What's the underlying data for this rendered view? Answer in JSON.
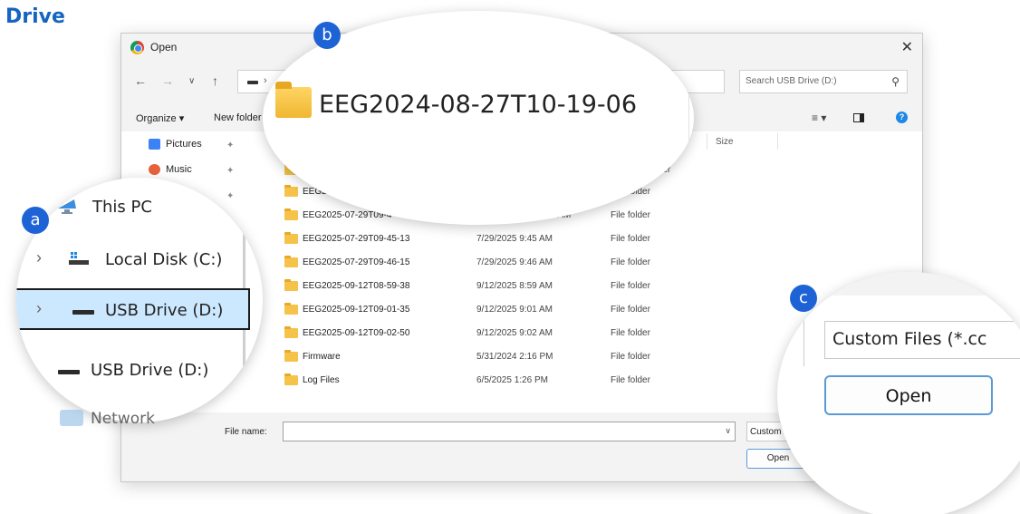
{
  "page": {
    "title": "Drive"
  },
  "dialog": {
    "title": "Open",
    "search_placeholder": "Search USB Drive (D:)",
    "toolbar": {
      "organize": "Organize ▾",
      "new_folder": "New folder"
    },
    "columns": {
      "size": "Size"
    },
    "nav_items": [
      {
        "label": "Pictures",
        "color": "#3b82f6"
      },
      {
        "label": "Music",
        "color": "#e8613c"
      },
      {
        "label": "s",
        "color": "#9ca3af"
      }
    ],
    "partial_text": {
      "nav_fragment": ":)",
      "row0_type": "older",
      "row1_name": "EEG20",
      "row2_name": "EEG2025-07-29T09-4",
      "row2_date": "44 AM"
    },
    "files": [
      {
        "name": "EEG2025-07-29T09-45-13",
        "date": "7/29/2025 9:45 AM",
        "type": "File folder"
      },
      {
        "name": "EEG2025-07-29T09-46-15",
        "date": "7/29/2025 9:46 AM",
        "type": "File folder"
      },
      {
        "name": "EEG2025-09-12T08-59-38",
        "date": "9/12/2025 8:59 AM",
        "type": "File folder"
      },
      {
        "name": "EEG2025-09-12T09-01-35",
        "date": "9/12/2025 9:01 AM",
        "type": "File folder"
      },
      {
        "name": "EEG2025-09-12T09-02-50",
        "date": "9/12/2025 9:02 AM",
        "type": "File folder"
      },
      {
        "name": "Firmware",
        "date": "5/31/2024 2:16 PM",
        "type": "File folder"
      },
      {
        "name": "Log Files",
        "date": "6/5/2025 1:26 PM",
        "type": "File folder"
      }
    ],
    "partial_rows_type": [
      "File folder",
      "File folder"
    ],
    "file_name_label": "File name:",
    "file_name_value": "",
    "filter_label": "Custom",
    "open_label": "Open"
  },
  "magnifier_b": {
    "folder_name": "EEG2024-08-27T10-19-06"
  },
  "magnifier_a": {
    "items": [
      {
        "label": "This PC"
      },
      {
        "label": "Local Disk (C:)"
      },
      {
        "label": "USB Drive (D:)",
        "selected": true
      },
      {
        "label": "USB Drive (D:)"
      }
    ],
    "network": "Network"
  },
  "magnifier_c": {
    "filter_text": "Custom Files (*.cc",
    "open_label": "Open"
  },
  "callouts": {
    "a": "a",
    "b": "b",
    "c": "c"
  },
  "colors": {
    "accent": "#1e63d6",
    "title": "#1565c0",
    "selection": "#cce8ff",
    "folder": "#f5c34a"
  }
}
